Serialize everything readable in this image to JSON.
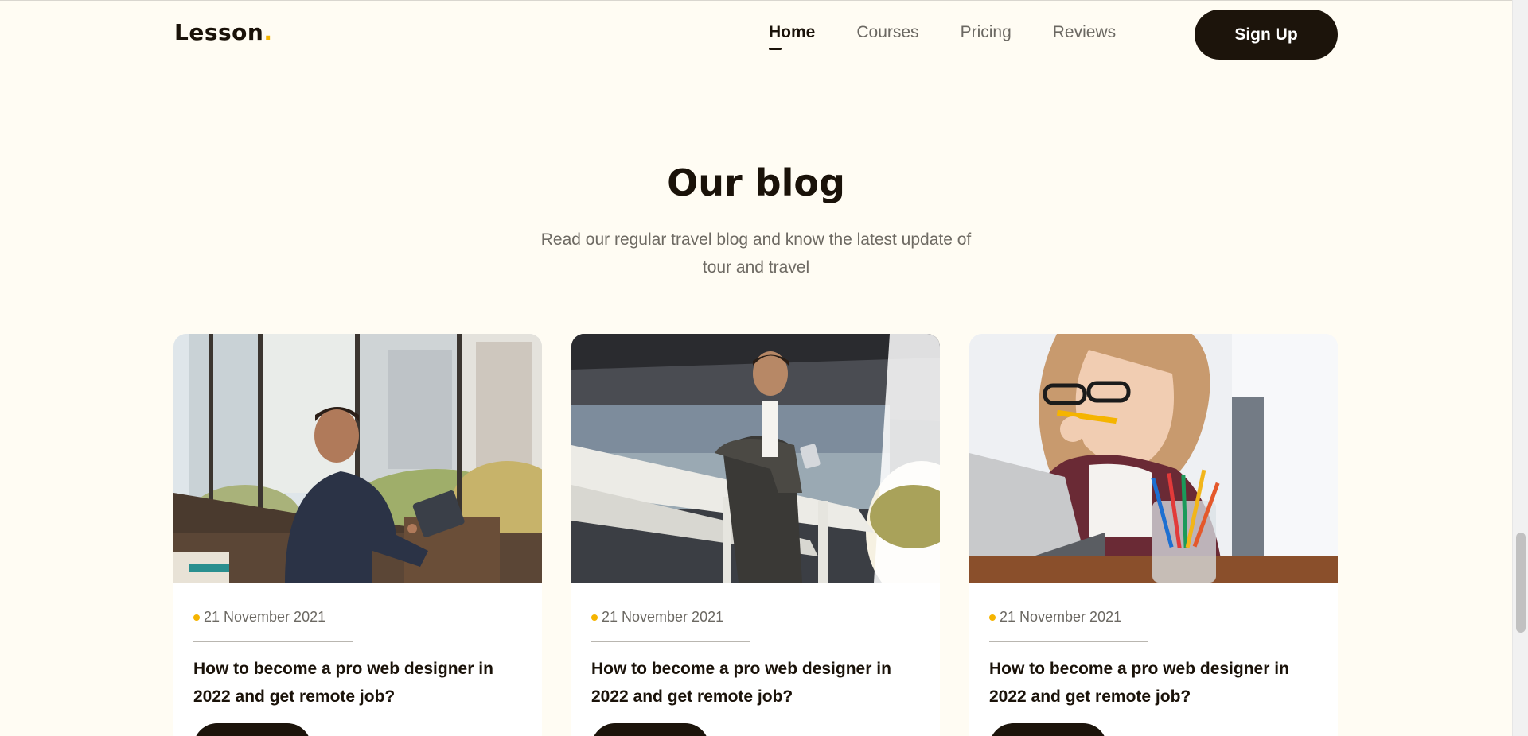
{
  "header": {
    "logo_text": "Lesson",
    "logo_dot": ".",
    "nav": [
      {
        "label": "Home",
        "active": true
      },
      {
        "label": "Courses",
        "active": false
      },
      {
        "label": "Pricing",
        "active": false
      },
      {
        "label": "Reviews",
        "active": false
      }
    ],
    "signup_label": "Sign Up"
  },
  "blog": {
    "title": "Our blog",
    "subtitle": "Read our regular travel blog and know the latest update of tour and travel",
    "posts": [
      {
        "date": "21 November 2021",
        "title": "How to become a pro web designer in 2022 and get remote job?",
        "image": "man-working-on-tablet-at-office-window"
      },
      {
        "date": "21 November 2021",
        "title": "How to become a pro web designer in 2022 and get remote job?",
        "image": "man-on-balcony-with-phone"
      },
      {
        "date": "21 November 2021",
        "title": "How to become a pro web designer in 2022 and get remote job?",
        "image": "woman-biting-pencil-at-laptop"
      }
    ]
  },
  "colors": {
    "background": "#fffcf3",
    "dark": "#1c140b",
    "accent": "#f5b400",
    "muted_text": "#6b6862"
  }
}
